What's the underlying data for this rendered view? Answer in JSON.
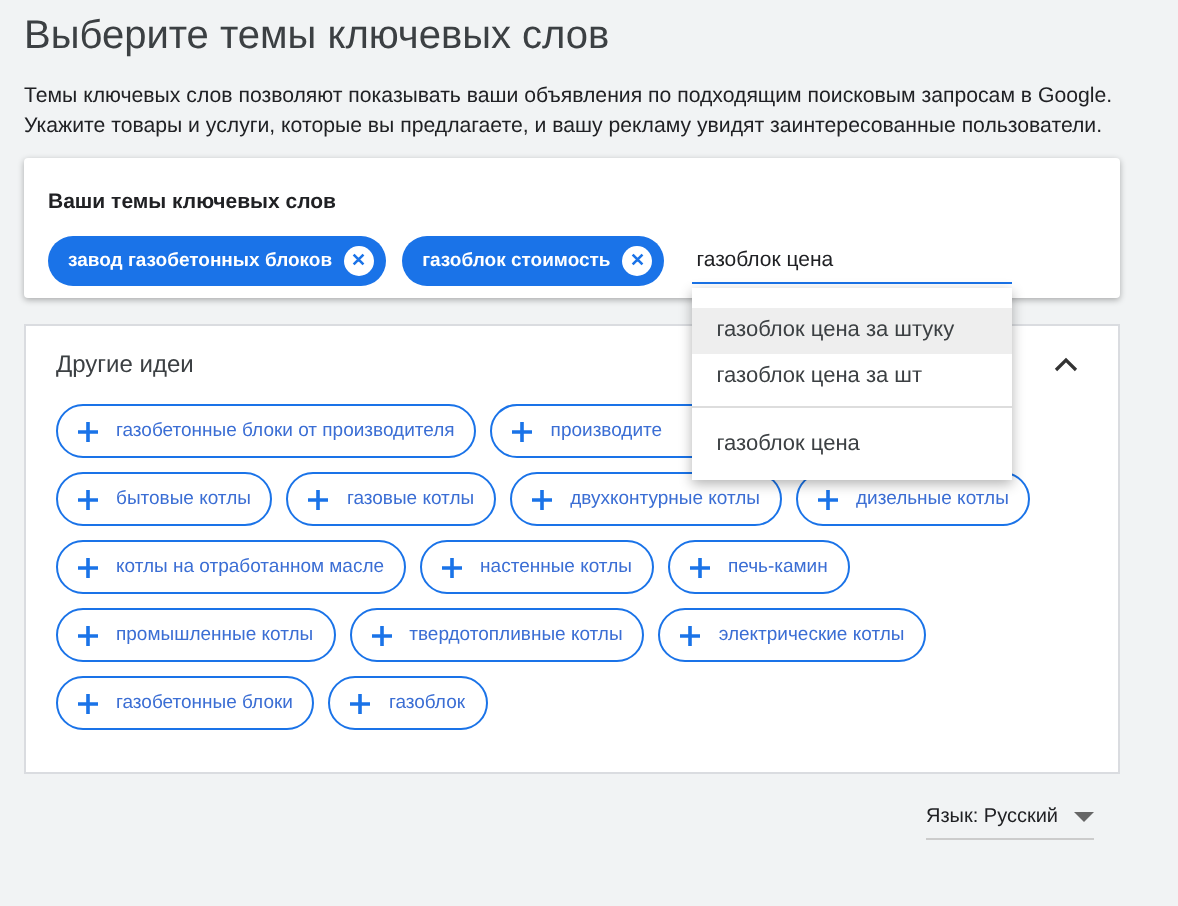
{
  "title": "Выберите темы ключевых слов",
  "description": "Темы ключевых слов позволяют показывать ваши объявления по подходящим поисковым запросам в Google. Укажите товары и услуги, которые вы предлагаете, и вашу рекламу увидят заинтересованные пользователи.",
  "keywords_card": {
    "label": "Ваши темы ключевых слов",
    "chips": [
      {
        "label": "завод газобетонных блоков",
        "remove": "✕"
      },
      {
        "label": "газоблок стоимость",
        "remove": "✕"
      }
    ],
    "input": {
      "value": "газоблок цена"
    },
    "suggestions": [
      {
        "label": "газоблок цена за штуку",
        "selected": true
      },
      {
        "label": "газоблок цена за шт",
        "selected": false
      },
      {
        "label": "газоблок цена",
        "selected": false
      }
    ]
  },
  "ideas": {
    "title": "Другие идеи",
    "expanded": true,
    "rows": [
      [
        {
          "label": "газобетонные блоки от производителя"
        },
        {
          "label": "производите"
        }
      ],
      [
        {
          "label": "бытовые котлы"
        },
        {
          "label": "газовые котлы"
        },
        {
          "label": "двухконтурные котлы"
        },
        {
          "label": "дизельные котлы"
        }
      ],
      [
        {
          "label": "котлы на отработанном масле"
        },
        {
          "label": "настенные котлы"
        },
        {
          "label": "печь-камин"
        }
      ],
      [
        {
          "label": "промышленные котлы"
        },
        {
          "label": "твердотопливные котлы"
        },
        {
          "label": "электрические котлы"
        }
      ],
      [
        {
          "label": "газобетонные блоки"
        },
        {
          "label": "газоблок"
        }
      ]
    ]
  },
  "language": {
    "label": "Язык:",
    "value": "Русский"
  }
}
